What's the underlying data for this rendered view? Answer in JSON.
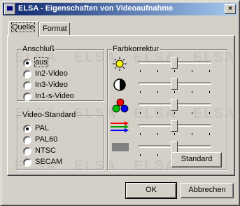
{
  "window": {
    "title": "ELSA - Eigenschaften von Videoaufnahme",
    "close_symbol": "×"
  },
  "tabs": [
    {
      "label": "Quelle",
      "active": true
    },
    {
      "label": "Format",
      "active": false
    }
  ],
  "watermark": "ELSA",
  "anschluss": {
    "label": "Anschluß",
    "options": [
      "aus",
      "In2-Video",
      "In3-Video",
      "In1-s-Video"
    ],
    "selected": "aus"
  },
  "video_standard": {
    "label": "Video-Standard",
    "options": [
      "PAL",
      "PAL60",
      "NTSC",
      "SECAM"
    ],
    "selected": "PAL"
  },
  "farbkorrektur": {
    "label": "Farbkorrektur",
    "sliders": [
      {
        "name": "brightness",
        "icon": "sun-icon"
      },
      {
        "name": "contrast",
        "icon": "contrast-icon"
      },
      {
        "name": "color",
        "icon": "rgb-circles-icon"
      },
      {
        "name": "hue",
        "icon": "color-lines-icon"
      },
      {
        "name": "sharpness",
        "icon": "gray-rect-icon"
      }
    ],
    "standard_button": "Standard"
  },
  "buttons": {
    "ok": "OK",
    "cancel": "Abbrechen"
  },
  "colors": {
    "titlebar_start": "#0a246a",
    "titlebar_end": "#a6caf0",
    "face": "#d4d0c8"
  }
}
